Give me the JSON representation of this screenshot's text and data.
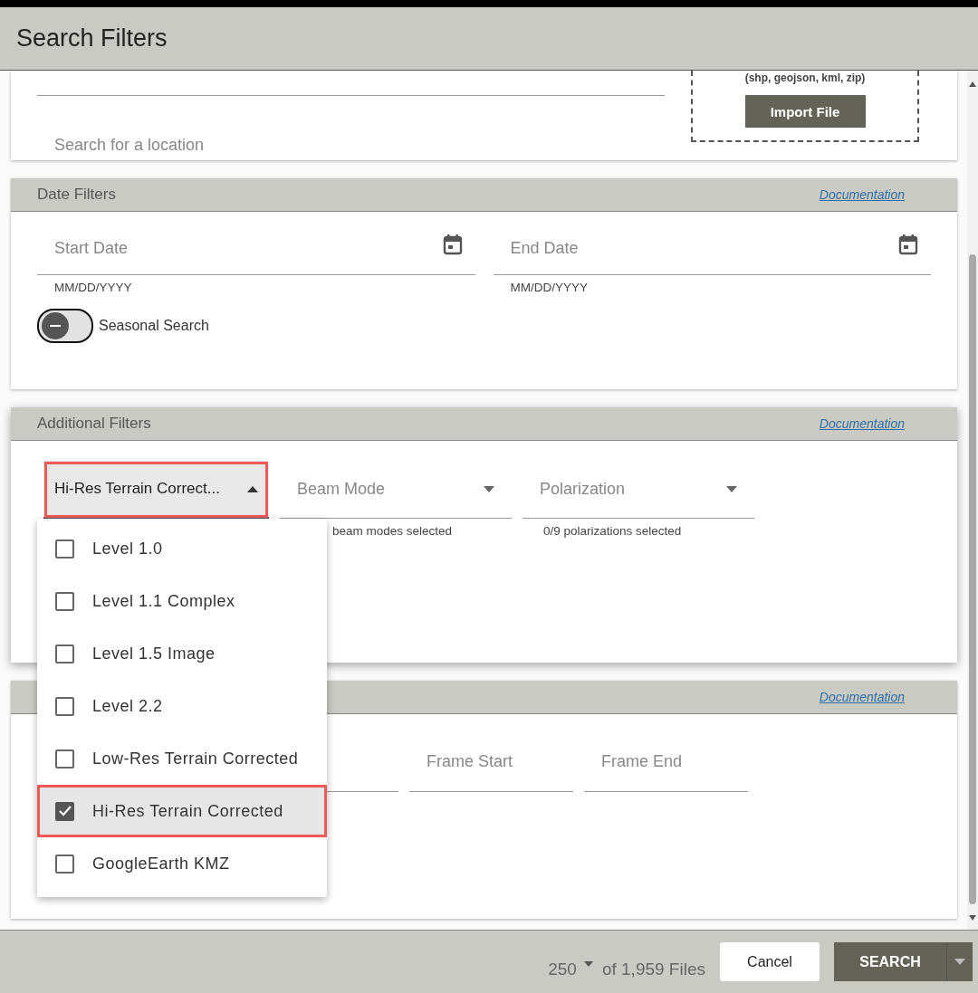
{
  "window": {
    "title": "Search Filters"
  },
  "area_panel": {
    "import_formats": "(shp, geojson, kml, zip)",
    "import_button": "Import File",
    "location_placeholder": "Search for a location"
  },
  "date_filters": {
    "title": "Date Filters",
    "doc_link": "Documentation",
    "fields": [
      {
        "placeholder": "Start Date",
        "hint": "MM/DD/YYYY"
      },
      {
        "placeholder": "End Date",
        "hint": "MM/DD/YYYY"
      }
    ],
    "seasonal_toggle": {
      "label": "Seasonal Search",
      "on": false
    }
  },
  "additional_filters": {
    "title": "Additional Filters",
    "doc_link": "Documentation",
    "dropdowns": [
      {
        "value": "Hi-Res Terrain Correct...",
        "expanded": true,
        "highlighted": true
      },
      {
        "placeholder": "Beam Mode",
        "hint": "beam modes selected",
        "expanded": false,
        "highlighted": false
      },
      {
        "placeholder": "Polarization",
        "hint": "0/9 polarizations selected",
        "expanded": false,
        "highlighted": false
      }
    ]
  },
  "path_frame_filters": {
    "doc_link": "Documentation",
    "fields": [
      {
        "placeholder": "Frame Start"
      },
      {
        "placeholder": "Frame End"
      }
    ]
  },
  "file_type_menu": [
    {
      "label": "Level 1.0",
      "checked": false,
      "highlighted": false
    },
    {
      "label": "Level 1.1 Complex",
      "checked": false,
      "highlighted": false
    },
    {
      "label": "Level 1.5 Image",
      "checked": false,
      "highlighted": false
    },
    {
      "label": "Level 2.2",
      "checked": false,
      "highlighted": false
    },
    {
      "label": "Low-Res Terrain Corrected",
      "checked": false,
      "highlighted": false
    },
    {
      "label": "Hi-Res Terrain Corrected",
      "checked": true,
      "highlighted": true
    },
    {
      "label": "GoogleEarth KMZ",
      "checked": false,
      "highlighted": false
    }
  ],
  "footer": {
    "max_results": "250",
    "file_count": "of 1,959 Files",
    "cancel_button": "Cancel",
    "search_button": "SEARCH"
  }
}
